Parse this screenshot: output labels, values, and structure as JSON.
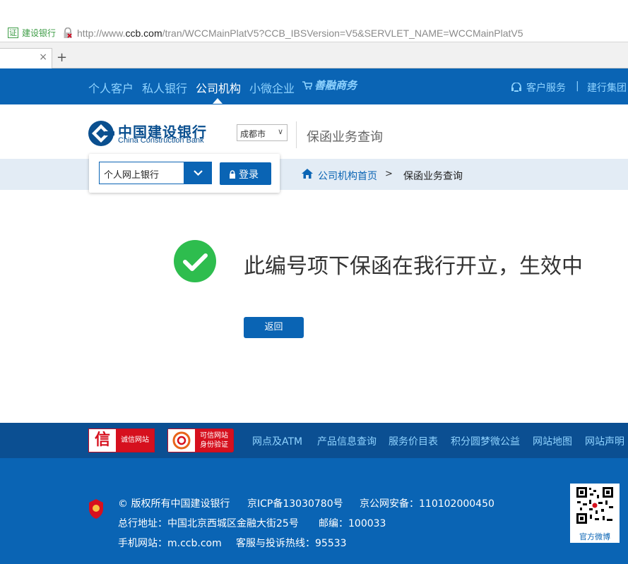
{
  "browser": {
    "cert_icon": "证",
    "cert_label": "建设银行",
    "url_prefix": "http://www.",
    "url_domain": "ccb.com",
    "url_path": "/tran/WCCMainPlatV5?CCB_IBSVersion=V5&SERVLET_NAME=WCCMainPlatV5",
    "tab_close": "×",
    "new_tab": "+"
  },
  "topnav": {
    "items": [
      {
        "label": "个人客户"
      },
      {
        "label": "私人银行"
      },
      {
        "label": "公司机构",
        "active": true
      },
      {
        "label": "小微企业"
      }
    ],
    "shanrong": "善融商务",
    "customer_service": "客户服务",
    "divider": "|",
    "group": "建行集团"
  },
  "header": {
    "logo_cn": "中国建设银行",
    "logo_en": "China Construction Bank",
    "city": "成都市",
    "page_heading": "保函业务查询"
  },
  "login": {
    "select_value": "个人网上银行",
    "button_label": "登录"
  },
  "breadcrumb": {
    "home": "公司机构首页",
    "separator": ">",
    "current": "保函业务查询"
  },
  "result": {
    "message": "此编号项下保函在我行开立，生效中",
    "back_button": "返回"
  },
  "footer": {
    "badge1_left": "信",
    "badge1_right": "诚信网站",
    "badge2_line1": "可信网站",
    "badge2_line2": "身份验证",
    "links": [
      "网点及ATM",
      "产品信息查询",
      "服务价目表",
      "积分圆梦微公益",
      "网站地图",
      "网站声明"
    ],
    "copyright": "© 版权所有中国建设银行",
    "icp": "京ICP备13030780号",
    "police": "京公网安备：110102000450",
    "address": "总行地址：中国北京西城区金融大街25号",
    "postcode": "邮编：100033",
    "mobile": "手机网站：m.ccb.com",
    "hotline": "客服与投诉热线：95533",
    "qr_label": "官方微博"
  },
  "colors": {
    "brand_blue": "#0a64b4",
    "nav_text": "#8fd3ff",
    "success_green": "#2ebd4e",
    "badge_red": "#d6101e"
  }
}
